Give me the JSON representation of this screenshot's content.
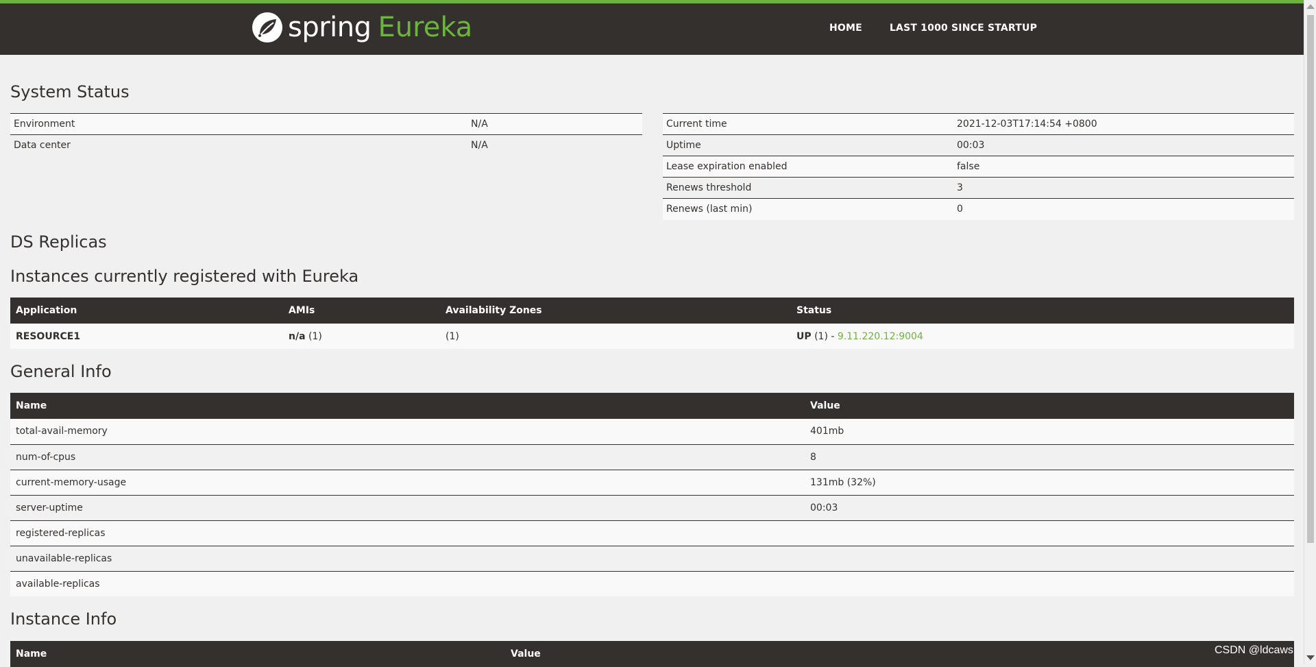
{
  "header": {
    "brand_spring": "spring",
    "brand_eureka": "Eureka",
    "nav": [
      {
        "label": "HOME"
      },
      {
        "label": "LAST 1000 SINCE STARTUP"
      }
    ],
    "colors": {
      "bar": "#34302d",
      "accent": "#6db33f"
    }
  },
  "system_status": {
    "title": "System Status",
    "left": [
      {
        "key": "Environment",
        "value": "N/A"
      },
      {
        "key": "Data center",
        "value": "N/A"
      }
    ],
    "right": [
      {
        "key": "Current time",
        "value": "2021-12-03T17:14:54 +0800"
      },
      {
        "key": "Uptime",
        "value": "00:03"
      },
      {
        "key": "Lease expiration enabled",
        "value": "false"
      },
      {
        "key": "Renews threshold",
        "value": "3"
      },
      {
        "key": "Renews (last min)",
        "value": "0"
      }
    ]
  },
  "ds_replicas": {
    "title": "DS Replicas"
  },
  "instances": {
    "title": "Instances currently registered with Eureka",
    "columns": [
      "Application",
      "AMIs",
      "Availability Zones",
      "Status"
    ],
    "rows": [
      {
        "application": "RESOURCE1",
        "amis_bold": "n/a",
        "amis_count": " (1)",
        "zones": "(1)",
        "status_bold": "UP",
        "status_count": " (1) - ",
        "status_link": "9.11.220.12:9004"
      }
    ]
  },
  "general_info": {
    "title": "General Info",
    "columns": [
      "Name",
      "Value"
    ],
    "rows": [
      {
        "name": "total-avail-memory",
        "value": "401mb"
      },
      {
        "name": "num-of-cpus",
        "value": "8"
      },
      {
        "name": "current-memory-usage",
        "value": "131mb (32%)"
      },
      {
        "name": "server-uptime",
        "value": "00:03"
      },
      {
        "name": "registered-replicas",
        "value": ""
      },
      {
        "name": "unavailable-replicas",
        "value": ""
      },
      {
        "name": "available-replicas",
        "value": ""
      }
    ]
  },
  "instance_info": {
    "title": "Instance Info",
    "columns": [
      "Name",
      "Value"
    ]
  },
  "watermark": "CSDN @ldcaws"
}
